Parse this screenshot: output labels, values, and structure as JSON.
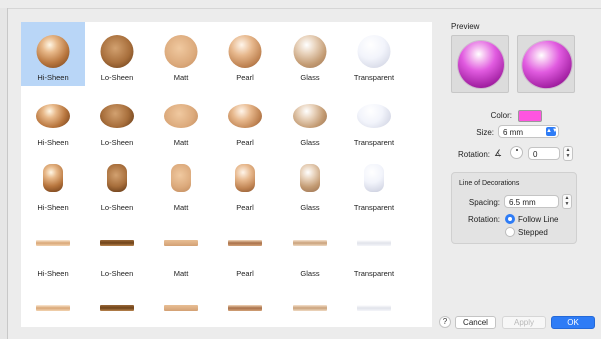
{
  "grid": {
    "rows": [
      {
        "shape": "round",
        "items": [
          "Hi-Sheen",
          "Lo-Sheen",
          "Matt",
          "Pearl",
          "Glass",
          "Transparent"
        ]
      },
      {
        "shape": "oval",
        "items": [
          "Hi-Sheen",
          "Lo-Sheen",
          "Matt",
          "Pearl",
          "Glass",
          "Transparent"
        ]
      },
      {
        "shape": "tall",
        "items": [
          "Hi-Sheen",
          "Lo-Sheen",
          "Matt",
          "Pearl",
          "Glass",
          "Transparent"
        ]
      },
      {
        "shape": "bar",
        "items": [
          "Hi-Sheen",
          "Lo-Sheen",
          "Matt",
          "Pearl",
          "Glass",
          "Transparent"
        ]
      },
      {
        "shape": "bar",
        "items": [
          "",
          "",
          "",
          "",
          "",
          ""
        ]
      }
    ],
    "selected": {
      "row": 0,
      "col": 0
    }
  },
  "preview": {
    "title": "Preview"
  },
  "settings": {
    "color_label": "Color:",
    "color_value": "#ff55e0",
    "size_label": "Size:",
    "size_value": "6 mm",
    "rotation_label": "Rotation:",
    "rotation_value": "0"
  },
  "line_of_decorations": {
    "title": "Line of Decorations",
    "spacing_label": "Spacing:",
    "spacing_value": "6.5 mm",
    "rotation_label": "Rotation:",
    "options": [
      "Follow Line",
      "Stepped"
    ],
    "selected": "Follow Line"
  },
  "footer": {
    "help": "?",
    "cancel": "Cancel",
    "apply": "Apply",
    "ok": "OK"
  }
}
